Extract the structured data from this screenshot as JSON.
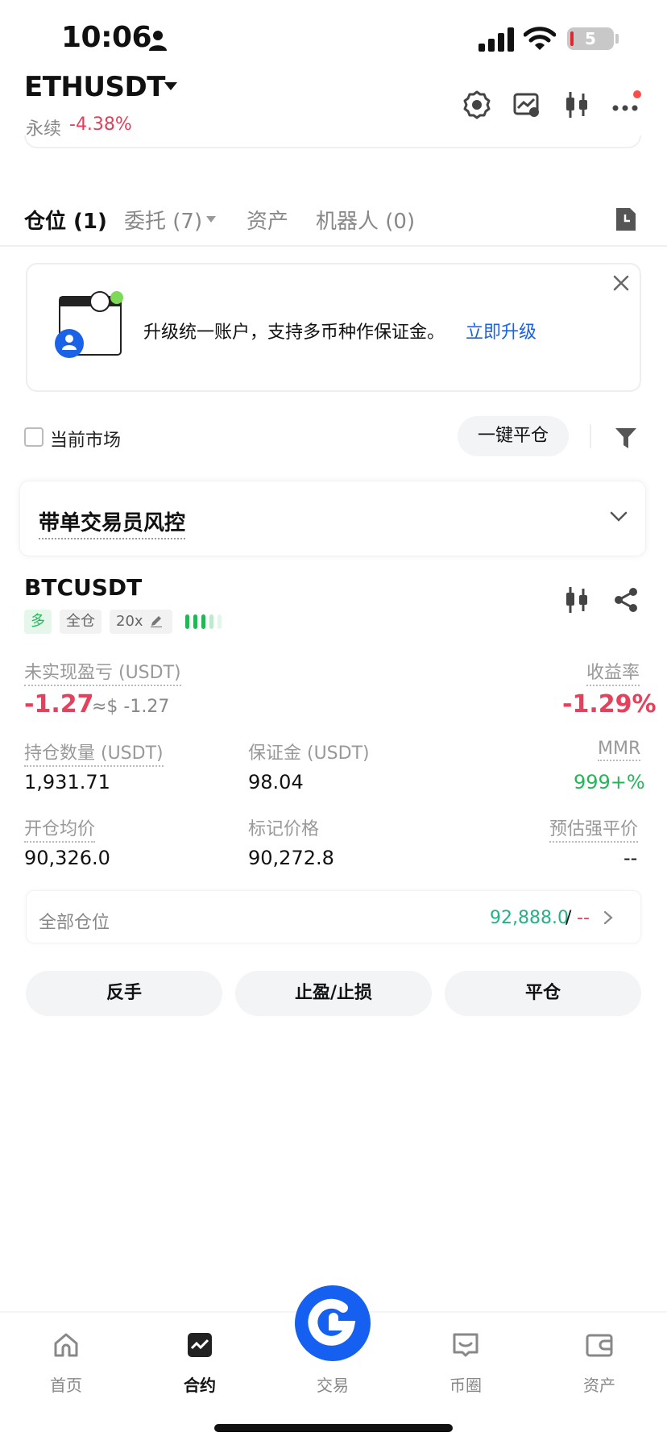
{
  "status_bar": {
    "time": "10:06",
    "battery": "5"
  },
  "header": {
    "symbol": "ETHUSDT",
    "contract_type": "永续",
    "change": "-4.38%"
  },
  "tabs": [
    {
      "label": "仓位 (1)"
    },
    {
      "label": "委托 (7)"
    },
    {
      "label": "资产"
    },
    {
      "label": "机器人 (0)"
    }
  ],
  "banner": {
    "text": "升级统一账户，支持多币种作保证金。",
    "link": "立即升级"
  },
  "filter": {
    "current_market": "当前市场",
    "close_all": "一键平仓"
  },
  "risk_control": {
    "title": "带单交易员风控"
  },
  "position": {
    "symbol": "BTCUSDT",
    "tags": {
      "side": "多",
      "margin_mode": "全仓",
      "leverage": "20x"
    },
    "unrealized_pnl_label": "未实现盈亏 (USDT)",
    "unrealized_pnl": "-1.27",
    "unrealized_pnl_usd": "≈$ -1.27",
    "roe_label": "收益率",
    "roe": "-1.29%",
    "size_label": "持仓数量 (USDT)",
    "size": "1,931.71",
    "margin_label": "保证金 (USDT)",
    "margin": "98.04",
    "mmr_label": "MMR",
    "mmr": "999+%",
    "entry_label": "开仓均价",
    "entry": "90,326.0",
    "mark_label": "标记价格",
    "mark": "90,272.8",
    "liq_label": "预估强平价",
    "liq": "--",
    "all_positions_label": "全部仓位",
    "all_positions_price": "92,888.0",
    "all_positions_slash": "/",
    "all_positions_other": "--"
  },
  "actions": {
    "reverse": "反手",
    "tpsl": "止盈/止损",
    "close": "平仓"
  },
  "nav": [
    {
      "label": "首页",
      "icon": "home-icon"
    },
    {
      "label": "合约",
      "icon": "futures-icon"
    },
    {
      "label": "交易",
      "icon": "trade-icon"
    },
    {
      "label": "币圈",
      "icon": "community-icon"
    },
    {
      "label": "资产",
      "icon": "wallet-icon"
    }
  ],
  "colors": {
    "accent": "#1560f0",
    "down": "#e5415c",
    "up": "#26b65a",
    "link": "#1a63e8"
  }
}
